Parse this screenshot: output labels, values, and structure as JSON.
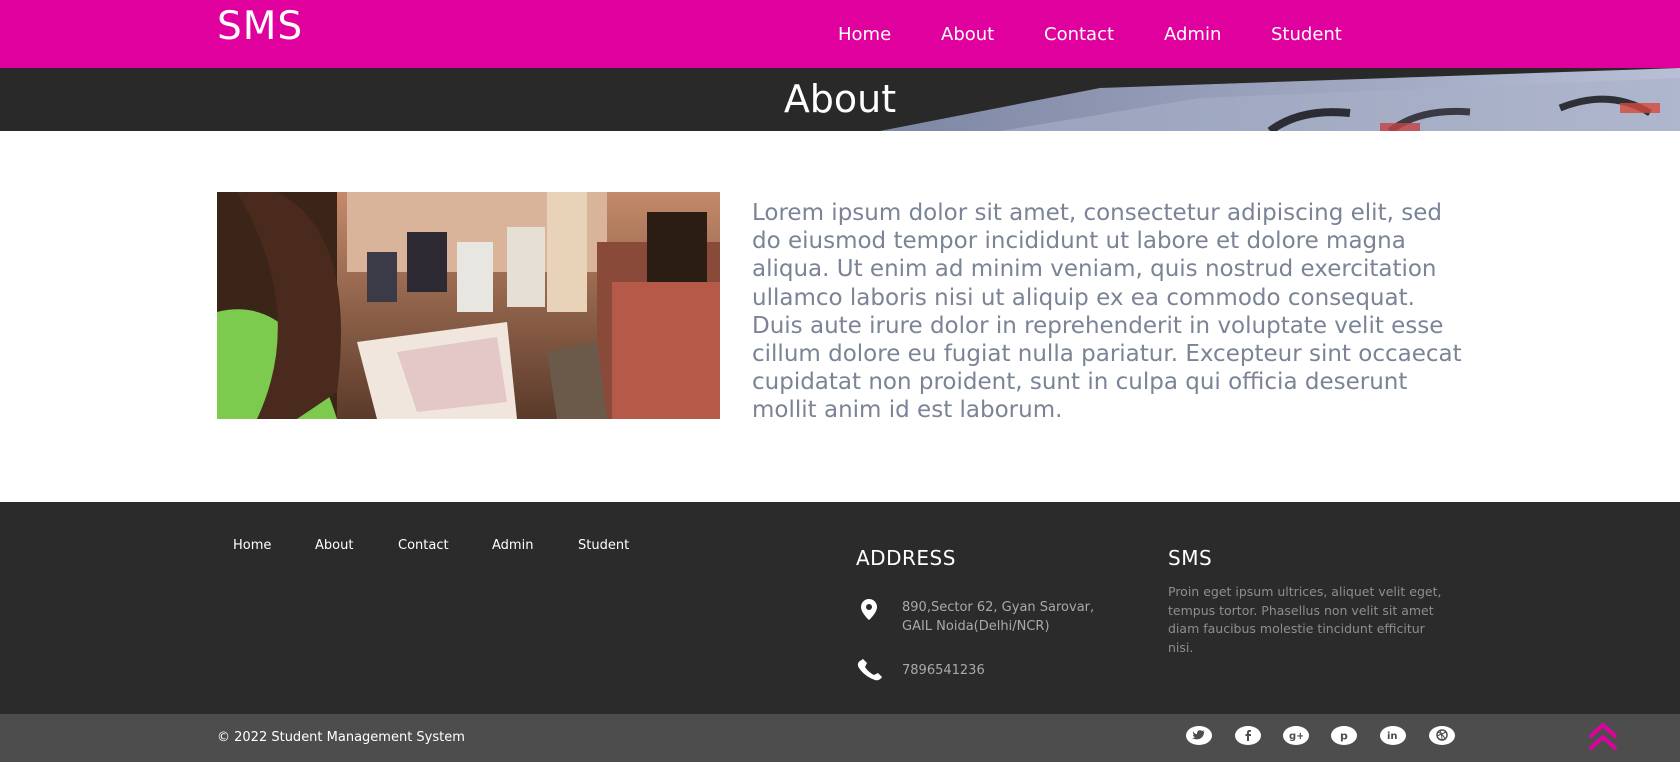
{
  "header": {
    "brand": "SMS",
    "nav": [
      "Home",
      "About",
      "Contact",
      "Admin",
      "Student"
    ]
  },
  "banner": {
    "title": "About"
  },
  "about": {
    "photo_icon": "classroom-photo",
    "text": "Lorem ipsum dolor sit amet, consectetur adipiscing elit, sed do eiusmod tempor incididunt ut labore et dolore magna aliqua. Ut enim ad minim veniam, quis nostrud exercitation ullamco laboris nisi ut aliquip ex ea commodo consequat. Duis aute irure dolor in reprehenderit in voluptate velit esse cillum dolore eu fugiat nulla pariatur. Excepteur sint occaecat cupidatat non proident, sunt in culpa qui officia deserunt mollit anim id est laborum."
  },
  "footer": {
    "nav": [
      "Home",
      "About",
      "Contact",
      "Admin",
      "Student"
    ],
    "address": {
      "heading": "ADDRESS",
      "line1": "890,Sector 62, Gyan Sarovar,",
      "line2": "GAIL Noida(Delhi/NCR)",
      "phone": "7896541236",
      "icons": [
        "map-pin-icon",
        "phone-icon"
      ]
    },
    "sms": {
      "heading": "SMS",
      "text": "Proin eget ipsum ultrices, aliquet velit eget, tempus tortor. Phasellus non velit sit amet diam faucibus molestie tincidunt efficitur nisi."
    }
  },
  "bottom": {
    "copyright": "© 2022 Student Management System",
    "social_icons": [
      "twitter-icon",
      "facebook-icon",
      "google-plus-icon",
      "pinterest-icon",
      "linkedin-icon",
      "dribbble-icon"
    ],
    "back_to_top_icon": "double-chevron-up-icon"
  },
  "colors": {
    "accent": "#e0009e",
    "header_bg": "#e0009e",
    "banner_bg": "#292929",
    "footer_bg": "#2b2b2b",
    "bottom_bar_bg": "#4d4d4d",
    "body_text": "#7a8496"
  }
}
